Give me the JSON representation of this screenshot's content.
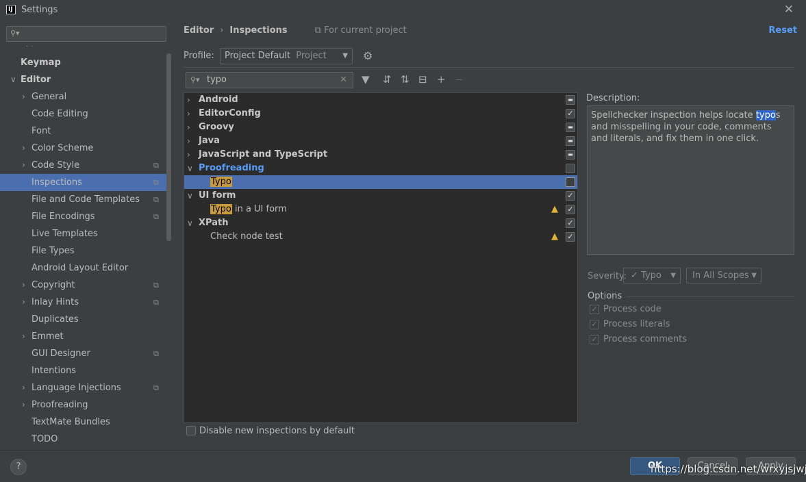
{
  "window": {
    "title": "Settings",
    "logo_text": "IJ",
    "close_glyph": "✕"
  },
  "sidebar": {
    "search_placeholder": "",
    "items": [
      {
        "label": "Keymap",
        "bold": true,
        "chevron": "",
        "project": false
      },
      {
        "label": "Editor",
        "bold": true,
        "chevron": "∨",
        "project": false
      },
      {
        "label": "General",
        "chevron": "›",
        "project": false
      },
      {
        "label": "Code Editing",
        "chevron": "",
        "project": false
      },
      {
        "label": "Font",
        "chevron": "",
        "project": false
      },
      {
        "label": "Color Scheme",
        "chevron": "›",
        "project": false
      },
      {
        "label": "Code Style",
        "chevron": "›",
        "project": true
      },
      {
        "label": "Inspections",
        "chevron": "",
        "project": true,
        "selected": true
      },
      {
        "label": "File and Code Templates",
        "chevron": "",
        "project": true
      },
      {
        "label": "File Encodings",
        "chevron": "",
        "project": true
      },
      {
        "label": "Live Templates",
        "chevron": "",
        "project": false
      },
      {
        "label": "File Types",
        "chevron": "",
        "project": false
      },
      {
        "label": "Android Layout Editor",
        "chevron": "",
        "project": false
      },
      {
        "label": "Copyright",
        "chevron": "›",
        "project": true
      },
      {
        "label": "Inlay Hints",
        "chevron": "›",
        "project": true
      },
      {
        "label": "Duplicates",
        "chevron": "",
        "project": false
      },
      {
        "label": "Emmet",
        "chevron": "›",
        "project": false
      },
      {
        "label": "GUI Designer",
        "chevron": "",
        "project": true
      },
      {
        "label": "Intentions",
        "chevron": "",
        "project": false
      },
      {
        "label": "Language Injections",
        "chevron": "›",
        "project": true
      },
      {
        "label": "Proofreading",
        "chevron": "›",
        "project": false
      },
      {
        "label": "TextMate Bundles",
        "chevron": "",
        "project": false
      },
      {
        "label": "TODO",
        "chevron": "",
        "project": false
      }
    ]
  },
  "breadcrumb": {
    "parent": "Editor",
    "current": "Inspections",
    "scope_note": "For current project",
    "reset": "Reset"
  },
  "profile": {
    "label": "Profile:",
    "value": "Project Default",
    "sub": "Project"
  },
  "filter": {
    "value": "typo"
  },
  "inspections": [
    {
      "type": "group",
      "label": "Android",
      "chevron": "›",
      "state": "mixed"
    },
    {
      "type": "group",
      "label": "EditorConfig",
      "chevron": "›",
      "state": "checked"
    },
    {
      "type": "group",
      "label": "Groovy",
      "chevron": "›",
      "state": "mixed"
    },
    {
      "type": "group",
      "label": "Java",
      "chevron": "›",
      "state": "mixed"
    },
    {
      "type": "group",
      "label": "JavaScript and TypeScript",
      "chevron": "›",
      "state": "mixed"
    },
    {
      "type": "group",
      "label": "Proofreading",
      "chevron": "∨",
      "state": "unchecked",
      "blue": true
    },
    {
      "type": "leaf",
      "highlight": "Typo",
      "rest": "",
      "state": "unchecked",
      "selected": true
    },
    {
      "type": "group",
      "label": "UI form",
      "chevron": "∨",
      "state": "checked"
    },
    {
      "type": "leaf",
      "highlight": "Typo",
      "rest": " in a UI form",
      "state": "checked",
      "warning": true
    },
    {
      "type": "group",
      "label": "XPath",
      "chevron": "∨",
      "state": "checked"
    },
    {
      "type": "leaf",
      "highlight": "",
      "rest": "Check node test",
      "state": "checked",
      "warning": true
    }
  ],
  "disable_new": {
    "label": "Disable new inspections by default",
    "checked": false
  },
  "description": {
    "label": "Description:",
    "before": "Spellchecker inspection helps locate ",
    "mark": "typo",
    "after": "s and misspelling in your code, comments and literals, and fix them in one click."
  },
  "severity": {
    "label": "Severity:",
    "value": "Typo",
    "scope": "In All Scopes"
  },
  "options": {
    "label": "Options",
    "items": [
      {
        "label": "Process code",
        "checked": true
      },
      {
        "label": "Process literals",
        "checked": true
      },
      {
        "label": "Process comments",
        "checked": true
      }
    ]
  },
  "buttons": {
    "help": "?",
    "ok": "OK",
    "cancel": "Cancel",
    "apply": "Apply"
  },
  "watermark": "https://blog.csdn.net/wrxyjsjwjs"
}
